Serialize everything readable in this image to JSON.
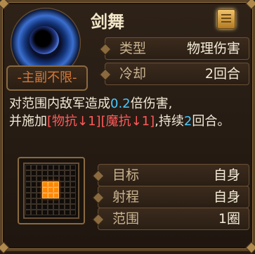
{
  "skill": {
    "name": "剑舞",
    "restriction": "-主副不限-",
    "description_parts": {
      "p1": "对范围内敌军造成",
      "p2": "0.2",
      "p3": "倍伤害,",
      "p4": "并施加",
      "p5": "[物抗↓1][魔抗↓1]",
      "p6": ",持续",
      "p7": "2",
      "p8": "回合。"
    }
  },
  "stats": [
    {
      "label": "类型",
      "value": "物理伤害"
    },
    {
      "label": "冷却",
      "value": "2回合"
    }
  ],
  "target_info": [
    {
      "label": "目标",
      "value": "自身"
    },
    {
      "label": "射程",
      "value": "自身"
    },
    {
      "label": "范围",
      "value": "1圈"
    }
  ],
  "colors": {
    "highlight": "#4ac8ff",
    "debuff": "#ff5a5a",
    "accent": "#d47a3a"
  },
  "icons": {
    "skill": "vortex-skill-icon",
    "help": "scroll-book-icon",
    "area": "area-grid-icon"
  }
}
